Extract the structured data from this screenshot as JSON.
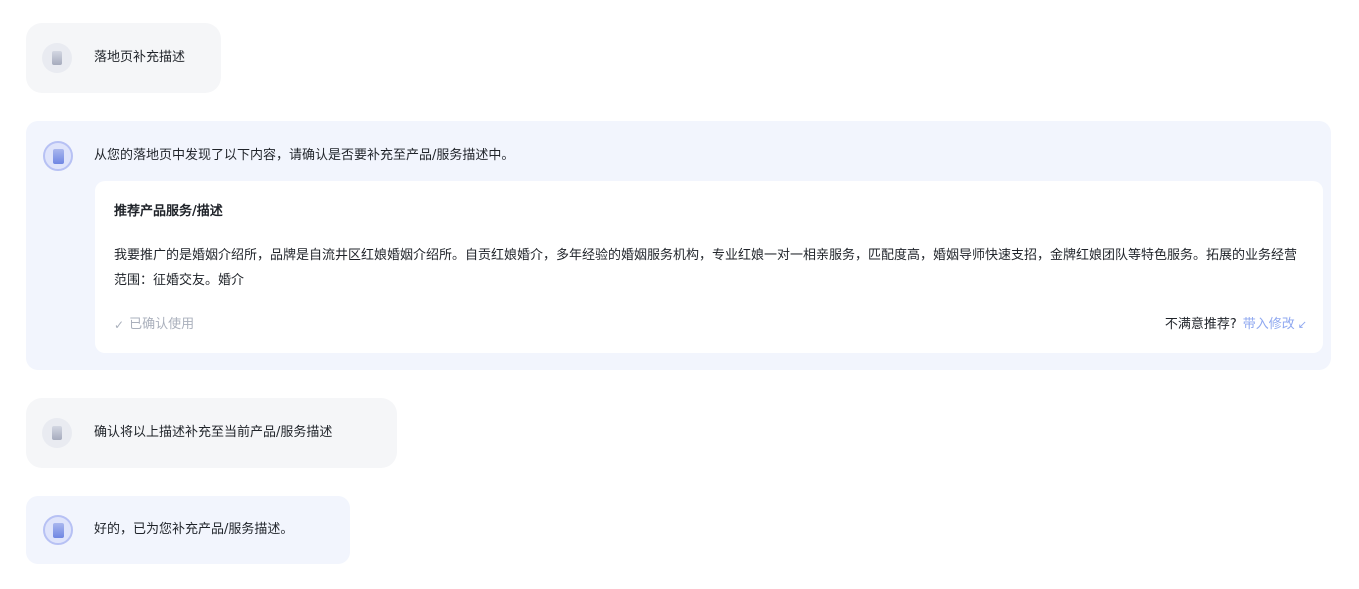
{
  "conversation": {
    "messages": [
      {
        "role": "user",
        "text": "落地页补充描述"
      },
      {
        "role": "assistant",
        "text": "从您的落地页中发现了以下内容，请确认是否要补充至产品/服务描述中。"
      },
      {
        "role": "user",
        "text": "确认将以上描述补充至当前产品/服务描述"
      },
      {
        "role": "assistant",
        "text": "好的，已为您补充产品/服务描述。"
      }
    ],
    "recommendation_card": {
      "title": "推荐产品服务/描述",
      "body": "我要推广的是婚姻介绍所，品牌是自流井区红娘婚姻介绍所。自贡红娘婚介，多年经验的婚姻服务机构，专业红娘一对一相亲服务，匹配度高，婚姻导师快速支招，金牌红娘团队等特色服务。拓展的业务经营范围：征婚交友。婚介",
      "status": "已确认使用",
      "feedback_question": "不满意推荐?",
      "edit_link": "带入修改"
    }
  },
  "icons": {
    "user_avatar": "user-avatar-icon",
    "ai_avatar": "assistant-avatar-icon",
    "check": "check-icon",
    "edit_arrow": "arrow-down-left-icon"
  },
  "colors": {
    "user_bubble": "#f5f6f8",
    "assistant_bubble": "#f2f5fd",
    "card": "#ffffff",
    "link": "#8fa8f0",
    "muted_text": "#aab0bc"
  }
}
